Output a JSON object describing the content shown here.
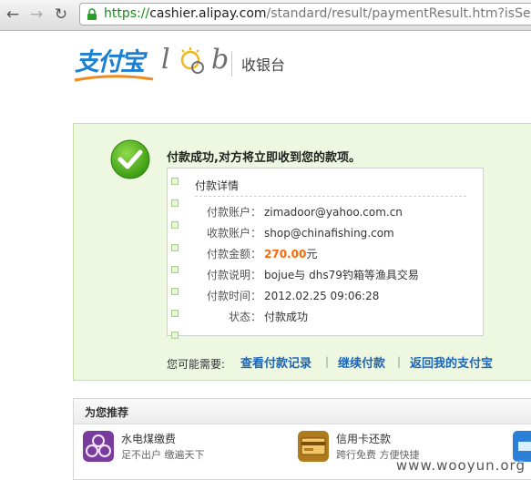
{
  "browser": {
    "url_protocol": "https://",
    "url_host": "cashier.alipay.com",
    "url_path": "/standard/result/paymentResult.htm?isSettleSuc"
  },
  "header": {
    "logo_text": "支付宝",
    "logo_lab": "l",
    "logo_lab_tail": "b",
    "title": "收银台"
  },
  "success": {
    "message": "付款成功,对方将立即收到您的款项。",
    "detail_title": "付款详情",
    "rows": [
      {
        "label": "付款账户：",
        "value": "zimadoor@yahoo.com.cn"
      },
      {
        "label": "收款账户：",
        "value": "shop@chinafishing.com"
      },
      {
        "label": "付款金额：",
        "value": "270.00",
        "unit": "元"
      },
      {
        "label": "付款说明：",
        "value": "bojue与 dhs79钓箱等渔具交易"
      },
      {
        "label": "付款时间：",
        "value": "2012.02.25 09:06:28"
      },
      {
        "label": "状态：",
        "value": "付款成功"
      }
    ],
    "actions_prefix": "您可能需要:",
    "actions": [
      "查看付款记录",
      "继续付款",
      "返回我的支付宝"
    ],
    "separator": "|"
  },
  "recommend": {
    "title": "为您推荐",
    "items": [
      {
        "name": "水电煤缴费",
        "desc": "足不出户 缴遍天下",
        "icon": "utility-payment-icon",
        "color": "#7a3c9c"
      },
      {
        "name": "信用卡还款",
        "desc": "跨行免费 方便快捷",
        "icon": "credit-card-icon",
        "color": "#b07a1e"
      }
    ]
  },
  "watermark": "www.wooyun.org",
  "colors": {
    "brand_blue": "#1c7fcf",
    "link": "#1c66b8",
    "amount": "#ff6600",
    "success_bg": "#eef8e0"
  }
}
